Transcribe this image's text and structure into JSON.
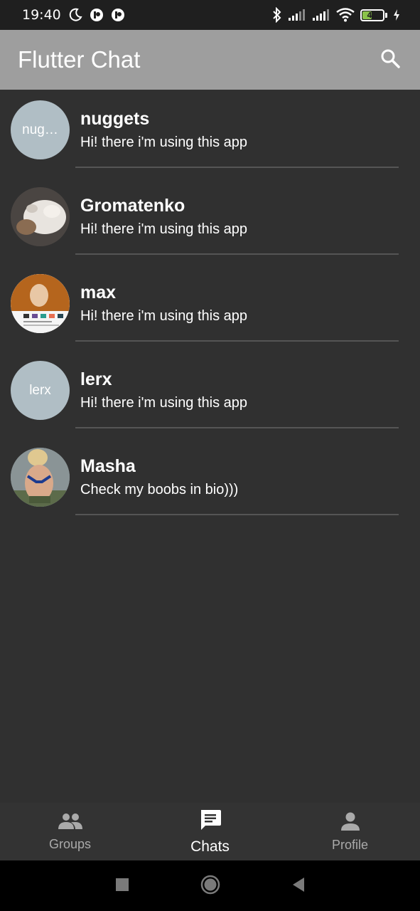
{
  "status_bar": {
    "time": "19:40",
    "battery_level": "43",
    "icons": [
      "do-not-disturb-icon",
      "app-notification-icon",
      "app-notification-icon",
      "bluetooth-icon",
      "signal-icon",
      "signal-icon",
      "wifi-icon",
      "battery-icon",
      "charging-icon"
    ]
  },
  "app_bar": {
    "title": "Flutter Chat",
    "search_icon": "search-icon"
  },
  "chats": [
    {
      "name": "nuggets",
      "message": "Hi! there i'm using this app",
      "avatar_text": "nug…",
      "avatar_type": "initials"
    },
    {
      "name": "Gromatenko",
      "message": "Hi! there i'm using this app",
      "avatar_text": "",
      "avatar_type": "photo-cat"
    },
    {
      "name": "max",
      "message": "Hi! there i'm using this app",
      "avatar_text": "",
      "avatar_type": "photo-person"
    },
    {
      "name": "lerx",
      "message": "Hi! there i'm using this app",
      "avatar_text": "lerx",
      "avatar_type": "initials"
    },
    {
      "name": "Masha",
      "message": "Check my boobs in bio)))",
      "avatar_text": "",
      "avatar_type": "photo-person"
    }
  ],
  "bottom_nav": {
    "items": [
      {
        "label": "Groups",
        "icon": "groups-icon",
        "active": false
      },
      {
        "label": "Chats",
        "icon": "chat-icon",
        "active": true
      },
      {
        "label": "Profile",
        "icon": "profile-icon",
        "active": false
      }
    ]
  },
  "system_nav": {
    "icons": [
      "recent-apps-icon",
      "home-icon",
      "back-icon"
    ]
  },
  "colors": {
    "app_bar": "#9e9e9e",
    "background": "#303030",
    "avatar_placeholder": "#b0bec5",
    "bottom_nav": "#333333"
  }
}
